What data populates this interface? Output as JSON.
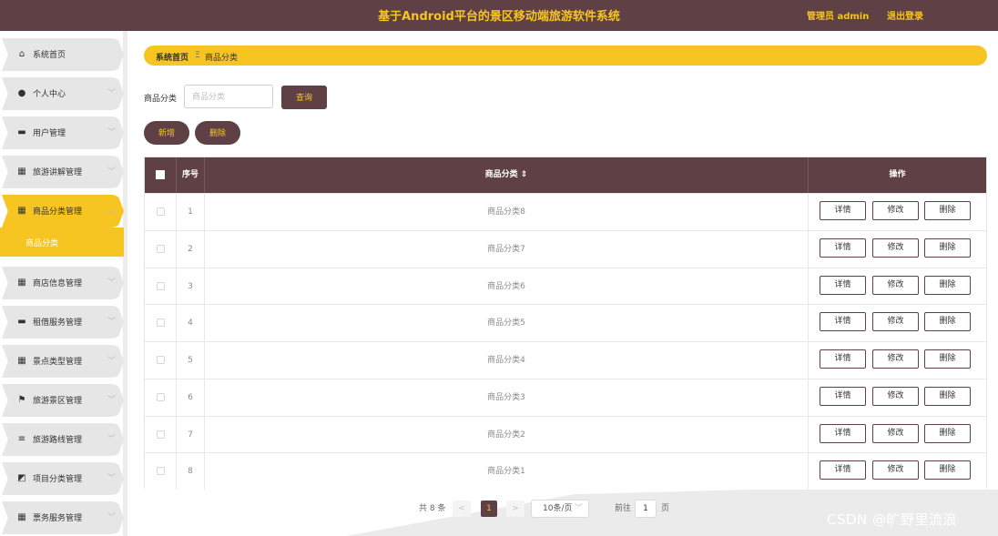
{
  "header": {
    "title": "基于Android平台的景区移动端旅游软件系统",
    "user_label": "管理员 admin",
    "logout_label": "退出登录"
  },
  "sidebar": {
    "items": [
      {
        "label": "系统首页",
        "icon": "home-icon",
        "glyph": "⌂",
        "expandable": false
      },
      {
        "label": "个人中心",
        "icon": "user-icon",
        "glyph": "●",
        "expandable": true
      },
      {
        "label": "用户管理",
        "icon": "chat-icon",
        "glyph": "▬",
        "expandable": true
      },
      {
        "label": "旅游讲解管理",
        "icon": "grid-icon",
        "glyph": "▦",
        "expandable": true
      },
      {
        "label": "商品分类管理",
        "icon": "grid-icon",
        "glyph": "▦",
        "expandable": true,
        "expanded": true
      },
      {
        "label": "商店信息管理",
        "icon": "grid-icon",
        "glyph": "▦",
        "expandable": true
      },
      {
        "label": "租借服务管理",
        "icon": "monitor-icon",
        "glyph": "▬",
        "expandable": true
      },
      {
        "label": "景点类型管理",
        "icon": "grid-icon",
        "glyph": "▦",
        "expandable": true
      },
      {
        "label": "旅游景区管理",
        "icon": "flag-icon",
        "glyph": "⚑",
        "expandable": true
      },
      {
        "label": "旅游路线管理",
        "icon": "list-icon",
        "glyph": "≡",
        "expandable": true
      },
      {
        "label": "项目分类管理",
        "icon": "chart-icon",
        "glyph": "◩",
        "expandable": true
      },
      {
        "label": "票务服务管理",
        "icon": "grid-icon",
        "glyph": "▦",
        "expandable": true
      }
    ],
    "submenu": {
      "label": "商品分类"
    },
    "chevron_down": "﹀",
    "chevron_up": "︿"
  },
  "breadcrumb": {
    "home": "系统首页",
    "separator": "Ξ",
    "current": "商品分类"
  },
  "search": {
    "label": "商品分类",
    "placeholder": "商品分类",
    "value": "",
    "button_label": "查询"
  },
  "actions": {
    "add_label": "新增",
    "delete_label": "删除"
  },
  "table": {
    "columns": {
      "index": "序号",
      "name": "商品分类 ⇕",
      "ops": "操作"
    },
    "op_labels": {
      "detail": "详情",
      "edit": "修改",
      "delete": "删除"
    },
    "rows": [
      {
        "index": "1",
        "name": "商品分类8"
      },
      {
        "index": "2",
        "name": "商品分类7"
      },
      {
        "index": "3",
        "name": "商品分类6"
      },
      {
        "index": "4",
        "name": "商品分类5"
      },
      {
        "index": "5",
        "name": "商品分类4"
      },
      {
        "index": "6",
        "name": "商品分类3"
      },
      {
        "index": "7",
        "name": "商品分类2"
      },
      {
        "index": "8",
        "name": "商品分类1"
      }
    ]
  },
  "pagination": {
    "total": "共 8 条",
    "prev": "<",
    "current_page": "1",
    "next": ">",
    "page_size": "10条/页",
    "page_size_chevron": "﹀",
    "goto_label": "前往",
    "goto_value": "1",
    "goto_unit": "页"
  },
  "watermark": "CSDN @旷野里流浪",
  "colors": {
    "brand_dark": "#5e4045",
    "accent_yellow": "#f7c521",
    "sidebar_item_bg": "#e6e6e6"
  }
}
